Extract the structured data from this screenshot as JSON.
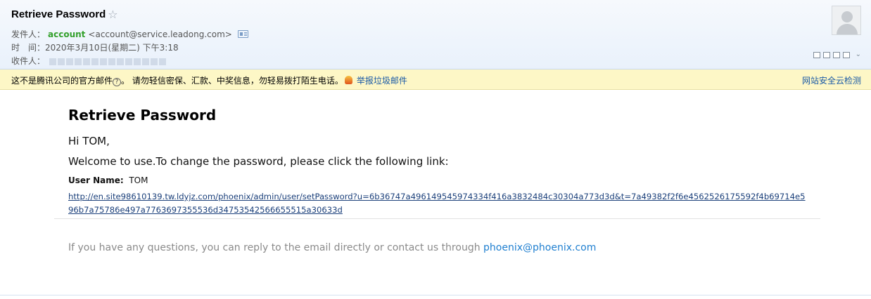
{
  "header": {
    "subject": "Retrieve Password",
    "star": "☆",
    "from_label": "发件人：",
    "sender_name": "account",
    "sender_addr": "<account@service.leadong.com>",
    "time_label": "时　间：",
    "time_value": "2020年3月10日(星期二) 下午3:18",
    "to_label": "收件人："
  },
  "warning": {
    "text": "这不是腾讯公司的官方邮件",
    "help_glyph": "?",
    "suffix": "。   请勿轻信密保、汇款、中奖信息，勿轻易拨打陌生电话。",
    "report_label": "举报垃圾邮件",
    "cloud_check_label": "网站安全云检测"
  },
  "email": {
    "title": "Retrieve Password",
    "greeting": "Hi TOM,",
    "welcome": "Welcome to use.To change the password, please click the following link:",
    "user_name_label": "User Name:",
    "user_name_value": "TOM",
    "reset_link": "http://en.site98610139.tw.ldyjz.com/phoenix/admin/user/setPassword?u=6b36747a496149545974334f416a3832484c30304a773d3d&t=7a49382f2f6e4562526175592f4b69714e596b7a75786e497a7763697355536d34753542566655515a30633d",
    "footer_text": "If you have any questions, you can reply to the email directly or contact us through ",
    "footer_email": "phoenix@phoenix.com"
  },
  "icons": [
    "star-icon",
    "contact-card-icon",
    "avatar-icon",
    "window-icon",
    "new-window-icon",
    "print-icon",
    "help-icon",
    "flame-icon",
    "chevron-down-icon"
  ]
}
